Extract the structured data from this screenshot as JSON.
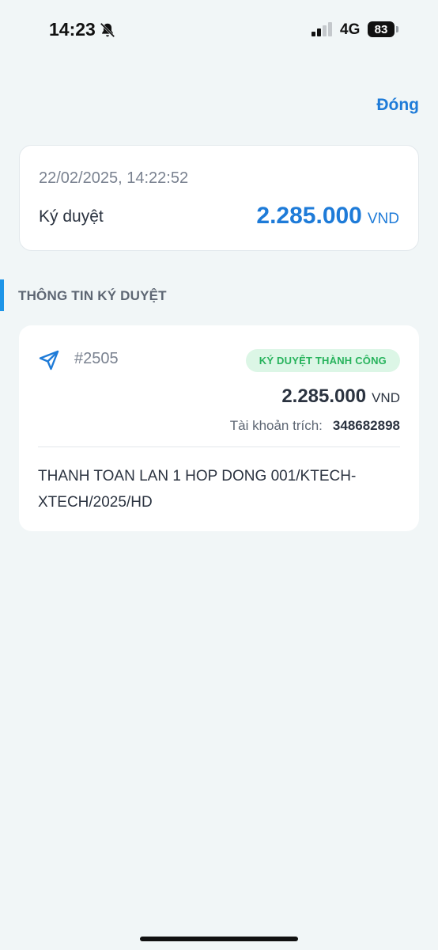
{
  "status_bar": {
    "time": "14:23",
    "network": "4G",
    "battery": "83"
  },
  "header": {
    "close_label": "Đóng"
  },
  "summary": {
    "datetime": "22/02/2025, 14:22:52",
    "label": "Ký duyệt",
    "amount": "2.285.000",
    "currency": "VND"
  },
  "section": {
    "title": "THÔNG TIN KÝ DUYỆT"
  },
  "detail": {
    "icon": "send-icon",
    "reference": "#2505",
    "status": "KÝ DUYỆT THÀNH CÔNG",
    "amount": "2.285.000",
    "currency": "VND",
    "account_label": "Tài khoản trích:",
    "account_number": "348682898",
    "description": "THANH TOAN LAN 1 HOP DONG 001/KTECH-XTECH/2025/HD"
  },
  "colors": {
    "accent": "#1e7bd8",
    "success_bg": "#dcf6e6",
    "success_text": "#27b35c",
    "background": "#f1f6f7"
  }
}
